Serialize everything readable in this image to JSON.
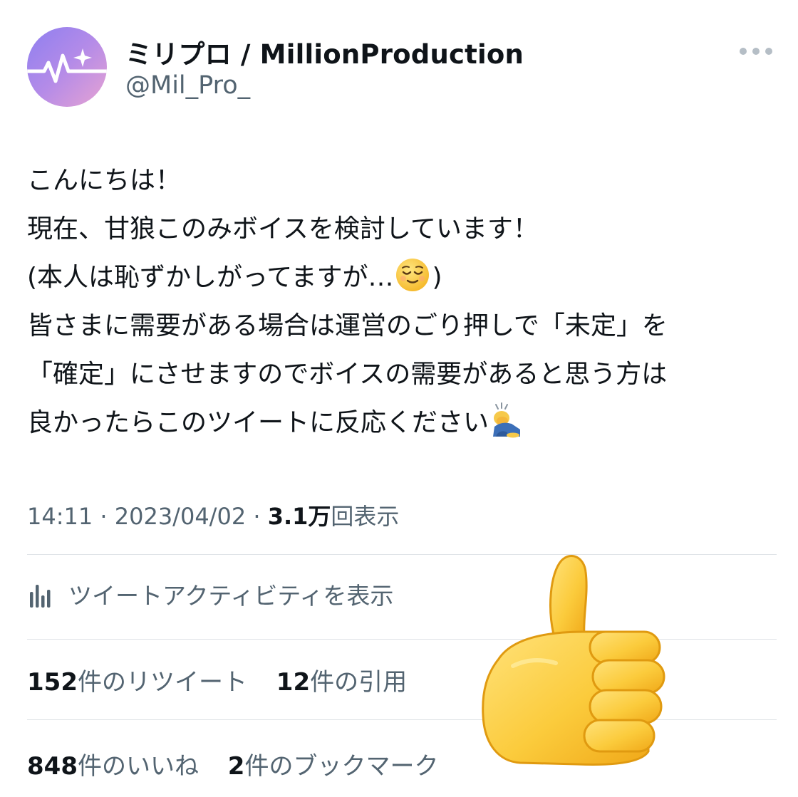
{
  "author": {
    "display_name": "ミリプロ / MillionProduction",
    "handle": "@Mil_Pro_",
    "avatar_icon": "million-production-logo-icon"
  },
  "menu_icon": "more-options-icon",
  "tweet": {
    "line1": "こんにちは！",
    "line2": "現在、甘狼このみボイスを検討しています！",
    "line3_before": "(本人は恥ずかしがってますが…",
    "line3_emoji": "relieved-face-emoji",
    "line3_after": ")",
    "line4": "皆さまに需要がある場合は運営のごり押しで「未定」を",
    "line5": "「確定」にさせますのでボイスの需要があると思う方は",
    "line6": "良かったらこのツイートに反応ください",
    "line6_emoji": "bowing-person-emoji"
  },
  "meta": {
    "time": "14:11",
    "separator": "·",
    "date": "2023/04/02",
    "views_count": "3.1万",
    "views_label": "回表示"
  },
  "activity": {
    "icon": "analytics-bar-chart-icon",
    "label": "ツイートアクティビティを表示"
  },
  "stats": {
    "retweets_count": "152",
    "retweets_label": "件のリツイート",
    "quotes_count": "12",
    "quotes_label": "件の引用",
    "likes_count": "848",
    "likes_label": "件のいいね",
    "bookmarks_count": "2",
    "bookmarks_label": "件のブックマーク"
  },
  "overlay_emoji": "thumbs-up-emoji",
  "colors": {
    "text_primary": "#0f1419",
    "text_secondary": "#536471",
    "divider": "#dfe3e7",
    "avatar_gradient_start": "#8e7ff0",
    "avatar_gradient_end": "#e7a3d2",
    "thumb_yellow": "#fbcb3c"
  }
}
